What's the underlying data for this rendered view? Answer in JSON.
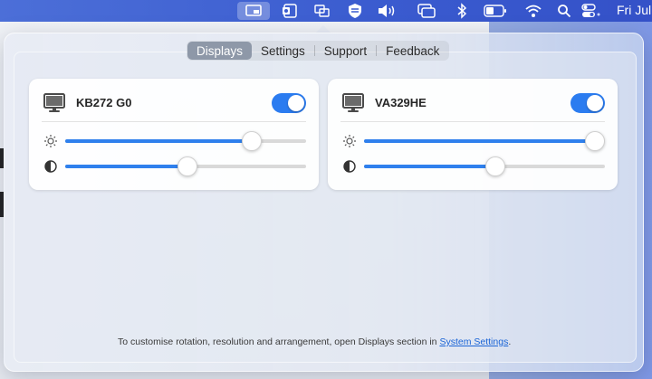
{
  "menubar": {
    "date_text": "Fri Jul",
    "icons": [
      "display-settings-icon",
      "outlook-icon",
      "display-mirror-icon",
      "shield-icon",
      "volume-icon",
      "window-switch-icon",
      "bluetooth-icon",
      "battery-icon",
      "wifi-icon",
      "search-icon",
      "control-center-icon"
    ]
  },
  "tabs": [
    {
      "label": "Displays",
      "selected": true
    },
    {
      "label": "Settings",
      "selected": false
    },
    {
      "label": "Support",
      "selected": false
    },
    {
      "label": "Feedback",
      "selected": false
    }
  ],
  "displays": [
    {
      "name": "KB272 G0",
      "enabled": true,
      "brightness": 0.8,
      "contrast": 0.51,
      "icon_brightness": "sun-icon",
      "icon_contrast": "contrast-icon",
      "icon_display": "monitor-icon"
    },
    {
      "name": "VA329HE",
      "enabled": true,
      "brightness": 1.0,
      "contrast": 0.55,
      "icon_brightness": "sun-icon",
      "icon_contrast": "contrast-icon",
      "icon_display": "monitor-icon"
    }
  ],
  "footer": {
    "text": "To customise rotation, resolution and arrangement, open Displays section in ",
    "link_label": "System Settings",
    "suffix": "."
  },
  "colors": {
    "accent": "#2f80ed",
    "toggle_on": "#2b7cf0",
    "tab_selected": "#8e98a8",
    "menubar": "#3a5bcf"
  }
}
